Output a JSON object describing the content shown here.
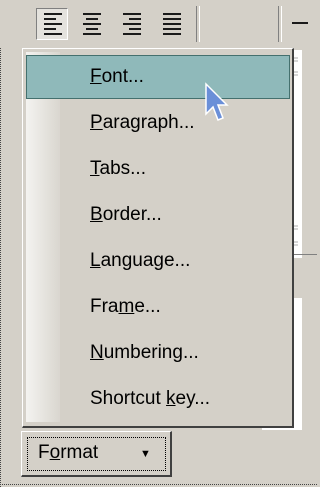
{
  "toolbar": {
    "buttons": [
      {
        "name": "align-left-icon"
      },
      {
        "name": "align-center-icon"
      },
      {
        "name": "align-right-icon"
      },
      {
        "name": "justify-icon"
      }
    ]
  },
  "document": {
    "peek_lines": [
      "xt",
      "le",
      "xt",
      "le",
      "xt"
    ],
    "side_lines": [
      "ria",
      "t,"
    ]
  },
  "menu": {
    "items": [
      {
        "pre": "",
        "key": "F",
        "post": "ont..."
      },
      {
        "pre": "",
        "key": "P",
        "post": "aragraph..."
      },
      {
        "pre": "",
        "key": "T",
        "post": "abs..."
      },
      {
        "pre": "",
        "key": "B",
        "post": "order..."
      },
      {
        "pre": "",
        "key": "L",
        "post": "anguage..."
      },
      {
        "pre": "Fra",
        "key": "m",
        "post": "e..."
      },
      {
        "pre": "",
        "key": "N",
        "post": "umbering..."
      },
      {
        "pre": "Shortcut ",
        "key": "k",
        "post": "ey..."
      }
    ],
    "highlight_color": "#8fb9ba"
  },
  "format_button": {
    "pre": "F",
    "key": "o",
    "post": "rmat",
    "arrow": "▼"
  }
}
